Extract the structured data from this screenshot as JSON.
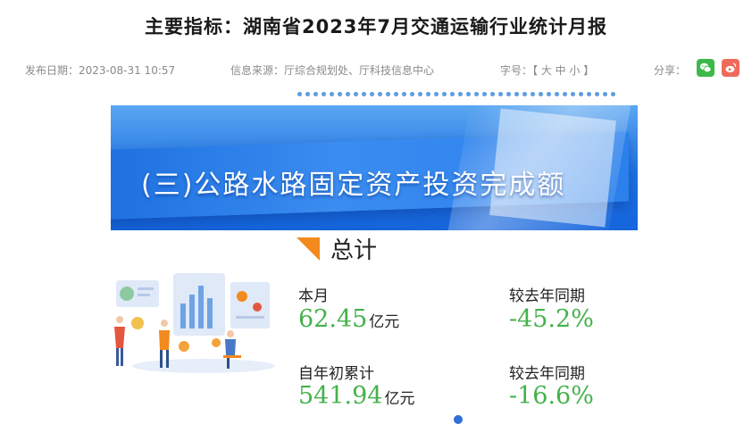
{
  "page": {
    "title": "主要指标：湖南省2023年7月交通运输行业统计月报"
  },
  "meta": {
    "publish_date": "发布日期：2023-08-31 10:57",
    "source": "信息来源：厅综合规划处、厅科技信息中心",
    "font_size": "字号：【 大 中 小 】",
    "share": "分享："
  },
  "banner": {
    "heading": "(三)公路水路固定资产投资完成额"
  },
  "section": {
    "title": "总计"
  },
  "stats": {
    "month_label": "本月",
    "month_value": "62.45",
    "month_unit": "亿元",
    "month_yoy_label": "较去年同期",
    "month_yoy_value": "-45.2%",
    "ytd_label": "自年初累计",
    "ytd_value": "541.94",
    "ytd_unit": "亿元",
    "ytd_yoy_label": "较去年同期",
    "ytd_yoy_value": "-16.6%"
  },
  "colors": {
    "value_green": "#44b24a",
    "banner_blue": "#1f73e3",
    "accent_orange": "#f28a1e",
    "wechat_green": "#3db84a",
    "weibo_red": "#ef6a5a"
  },
  "icons": [
    "wechat-icon",
    "weibo-icon",
    "section-arrow-icon",
    "data-analysis-illustration"
  ]
}
